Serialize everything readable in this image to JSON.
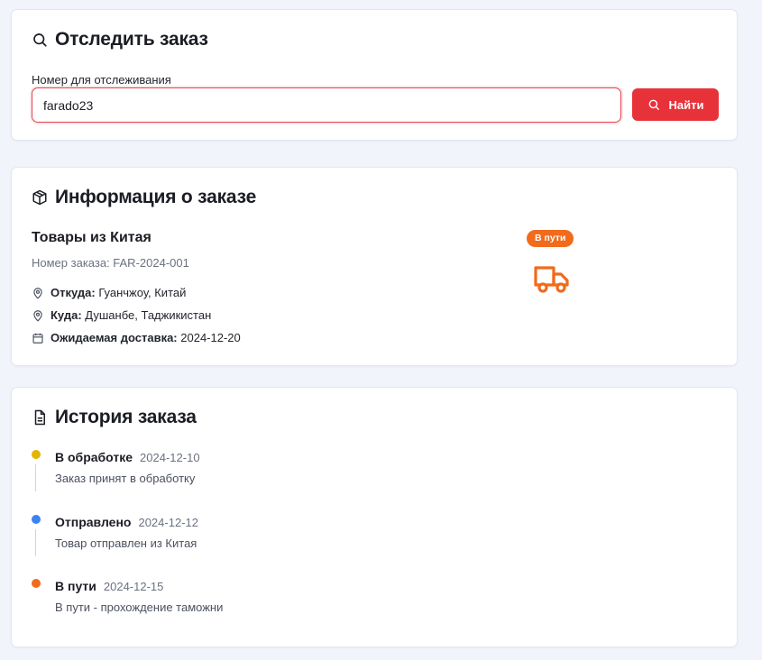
{
  "track": {
    "title": "Отследить заказ",
    "field_label": "Номер для отслеживания",
    "input_value": "farado23",
    "button_label": "Найти"
  },
  "info": {
    "title": "Информация о заказе",
    "product_name": "Товары из Китая",
    "order_number": "Номер заказа: FAR-2024-001",
    "from_label": "Откуда:",
    "from_value": "Гуанчжоу, Китай",
    "to_label": "Куда:",
    "to_value": "Душанбе, Таджикистан",
    "delivery_label": "Ожидаемая доставка:",
    "delivery_value": "2024-12-20",
    "status_badge": "В пути",
    "status_icon": "truck-icon"
  },
  "history": {
    "title": "История заказа",
    "items": [
      {
        "status": "В обработке",
        "date": "2024-12-10",
        "description": "Заказ принят в обработку",
        "color": "#e5b400"
      },
      {
        "status": "Отправлено",
        "date": "2024-12-12",
        "description": "Товар отправлен из Китая",
        "color": "#3b82f6"
      },
      {
        "status": "В пути",
        "date": "2024-12-15",
        "description": "В пути - прохождение таможни",
        "color": "#f26a1b"
      }
    ]
  },
  "colors": {
    "accent_red": "#e8323a",
    "accent_orange": "#f26a1b",
    "background": "#f1f4fa"
  }
}
